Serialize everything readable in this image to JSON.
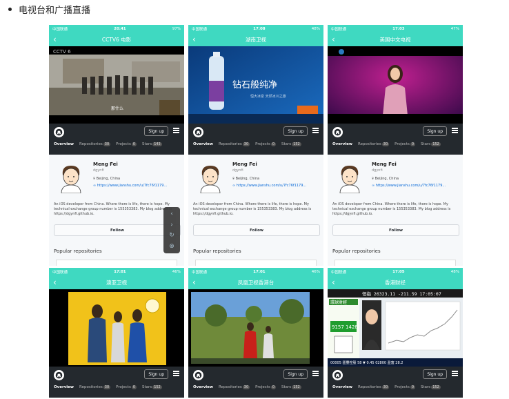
{
  "heading": "电视台和广播直播",
  "github": {
    "sign_up": "Sign up",
    "tabs": [
      "Overview",
      "Repositories",
      "Projects",
      "Stars"
    ],
    "counts": [
      "30",
      "0",
      "143"
    ],
    "counts_alt": [
      "30",
      "0",
      "152"
    ]
  },
  "profile": {
    "name": "Meng Fei",
    "username": "dgynfi",
    "location": "Beijing, China",
    "link": "https://www.jianshu.com/u/7fc76f1179...",
    "bio": "An iOS developer from China. Where there is life, there is hope. My technical exchange group number is 155353383. My blog address is https://dgynfi.github.io.",
    "follow": "Follow",
    "popular": "Popular repositories"
  },
  "phones": [
    {
      "carrier": "中国联通",
      "time": "20:41",
      "battery": "97%",
      "title": "CCTV6 电影",
      "caption": "那什么"
    },
    {
      "carrier": "中国联通",
      "time": "17:08",
      "battery": "48%",
      "title": "湖南卫视",
      "ad_text": "钻石般纯净",
      "ad_sub": "恒大冰泉 天然冰川之旅"
    },
    {
      "carrier": "中国联通",
      "time": "17:03",
      "battery": "47%",
      "title": "美国中文电视"
    },
    {
      "carrier": "中国联通",
      "time": "17:01",
      "battery": "46%",
      "title": "澳亚卫视"
    },
    {
      "carrier": "中国联通",
      "time": "17:01",
      "battery": "46%",
      "title": "凤凰卫视香港台"
    },
    {
      "carrier": "中国联通",
      "time": "17:05",
      "battery": "48%",
      "title": "香港财经",
      "ticker": "恒指 26323.11  -211.59  17:05:07",
      "phone_num": "9157 1428",
      "promo": "環球財經",
      "stock": "00005 匯豐控股 58  ▼ 0.45     02800 盈富 28.2"
    }
  ],
  "colors": {
    "accent": "#3fd9c1",
    "ghbar": "#24292e",
    "link": "#0366d6"
  }
}
